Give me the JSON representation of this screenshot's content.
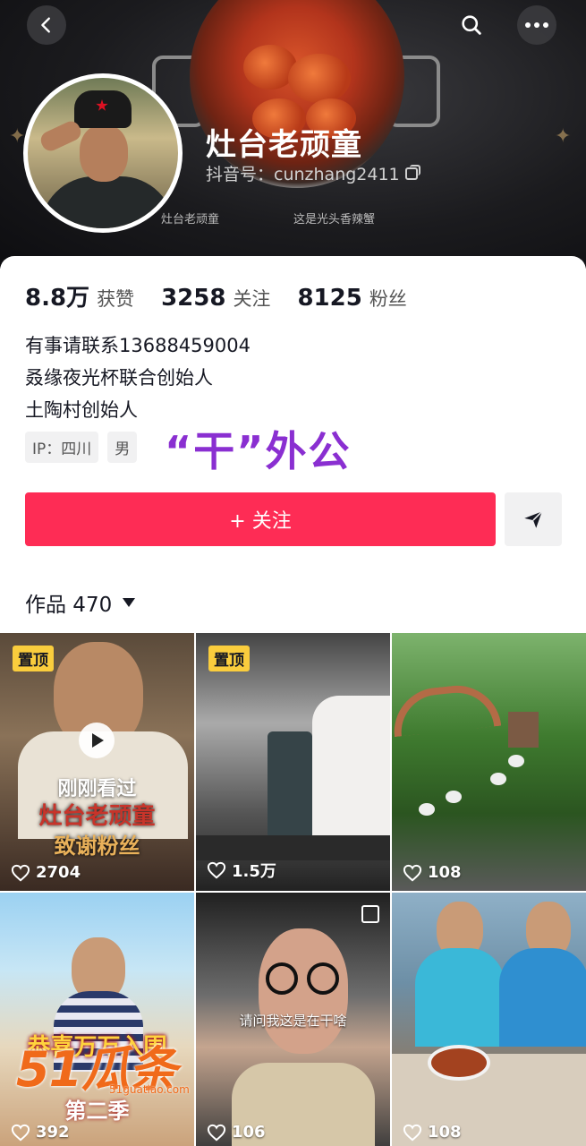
{
  "header": {
    "back_icon": "chevron-left-icon",
    "search_icon": "search-icon",
    "more_icon": "more-horizontal-icon",
    "cover_caption_left": "灶台老顽童",
    "cover_caption_right": "这是光头香辣蟹"
  },
  "profile": {
    "name": "灶台老顽童",
    "douyin_id": "抖音号：cunzhang2411",
    "stats": [
      {
        "value": "8.8万",
        "label": "获赞"
      },
      {
        "value": "3258",
        "label": "关注"
      },
      {
        "value": "8125",
        "label": "粉丝"
      }
    ],
    "bio": [
      "有事请联系13688459004",
      "叒缘夜光杯联合创始人",
      "土陶村创始人"
    ],
    "tags": [
      "IP：四川",
      "男"
    ],
    "overlay_title": "“干”外公",
    "follow_label": "+ 关注",
    "share_icon": "send-icon"
  },
  "works": {
    "label": "作品 470",
    "videos": [
      {
        "likes": "2704",
        "pinned": "置顶",
        "status": "刚刚看过",
        "thumb_text": "灶台老顽童",
        "thumb_text2": "致谢粉丝"
      },
      {
        "likes": "1.5万",
        "pinned": "置顶"
      },
      {
        "likes": "108"
      },
      {
        "likes": "392",
        "thumb_text": "恭喜万万入围",
        "thumb_text2": "第二季"
      },
      {
        "likes": "106",
        "subtitle": "请问我这是在干啥"
      },
      {
        "likes": "108"
      }
    ]
  },
  "watermark": {
    "main": "51瓜条",
    "sub": "51guatiao.com"
  },
  "colors": {
    "accent": "#fe2c55",
    "overlay_title": "#8a2fd1",
    "pinned": "#facd3d"
  }
}
